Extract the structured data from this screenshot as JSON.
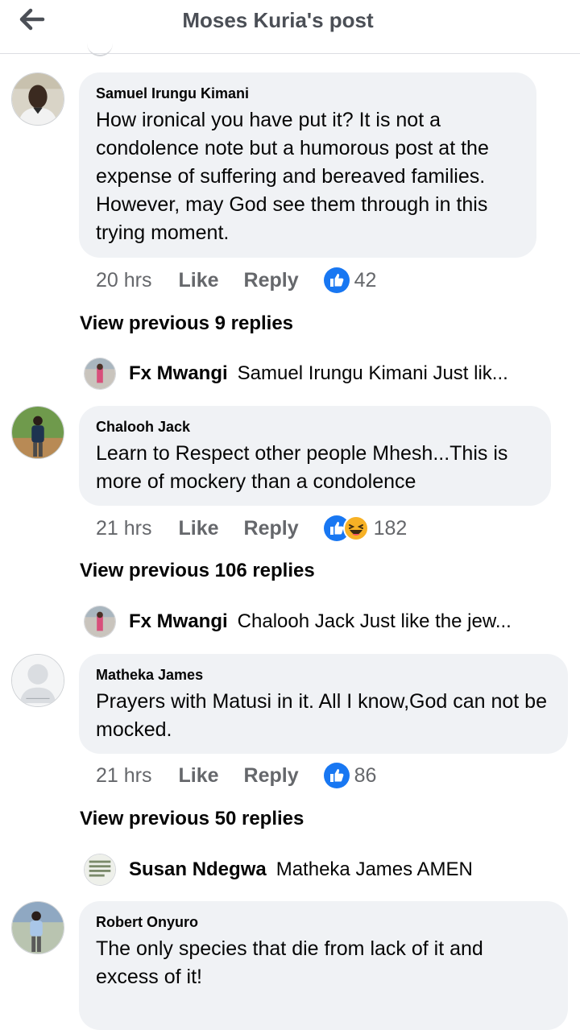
{
  "header": {
    "title": "Moses Kuria's post"
  },
  "comments": [
    {
      "author": "Samuel Irungu Kimani",
      "text": "How ironical you have put it? It is not a condolence note but a humorous post at the expense of suffering and bereaved families. However, may God see them through in this trying moment.",
      "time": "20 hrs",
      "like": "Like",
      "reply": "Reply",
      "reactions": "42",
      "view_previous": "View previous 9 replies",
      "latest_reply": {
        "author": "Fx Mwangi",
        "text": "Samuel Irungu Kimani Just lik..."
      }
    },
    {
      "author": "Chalooh Jack",
      "text": "Learn to Respect other people Mhesh...This is more of mockery than a condolence",
      "time": "21 hrs",
      "like": "Like",
      "reply": "Reply",
      "reactions": "182",
      "view_previous": "View previous 106 replies",
      "latest_reply": {
        "author": "Fx Mwangi",
        "text": "Chalooh Jack Just like the jew..."
      }
    },
    {
      "author": "Matheka James",
      "text": "Prayers with Matusi in it. All I know,God can not be mocked.",
      "time": "21 hrs",
      "like": "Like",
      "reply": "Reply",
      "reactions": "86",
      "view_previous": "View previous 50 replies",
      "latest_reply": {
        "author": "Susan Ndegwa",
        "text": "Matheka James AMEN"
      }
    },
    {
      "author": "Robert Onyuro",
      "text": "The only species that die from lack of it and excess of it!"
    }
  ],
  "colors": {
    "like_blue": "#1877f2",
    "haha_yellow": "#f7b125",
    "bubble_bg": "#f0f2f5",
    "meta_grey": "#65676b"
  }
}
